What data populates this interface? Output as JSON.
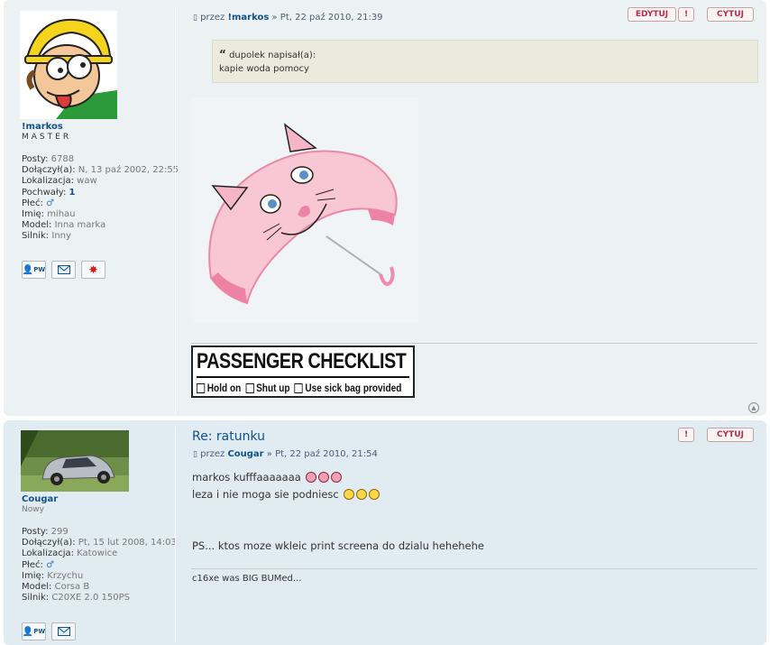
{
  "post1": {
    "author_name": "!markos",
    "rank": "MASTER",
    "fields": [
      {
        "label": "Posty:",
        "value": "6788"
      },
      {
        "label": "Dołączył(a):",
        "value": "N, 13 paź 2002, 22:55"
      },
      {
        "label": "Lokalizacja:",
        "value": "waw"
      },
      {
        "label": "Pochwały:",
        "value": "1"
      },
      {
        "label": "Płeć:",
        "value": "♂"
      },
      {
        "label": "Imię:",
        "value": "mihau"
      },
      {
        "label": "Model:",
        "value": "Inna marka"
      },
      {
        "label": "Silnik:",
        "value": "Inny"
      }
    ],
    "byline_prefix": "przez",
    "byline_author": "!markos",
    "byline_date": "» Pt, 22 paź 2010, 21:39",
    "buttons": {
      "edit": "EDYTUJ",
      "report": "!",
      "quote": "CYTUJ"
    },
    "quote": {
      "cite": "dupolek napisał(a):",
      "text": "kapie woda pomocy"
    },
    "checklist": {
      "title": "PASSENGER CHECKLIST",
      "items": [
        "Hold on",
        "Shut up",
        "Use sick bag provided"
      ]
    },
    "contact_icons": [
      "pm-icon",
      "email-icon",
      "www-icon"
    ]
  },
  "post2": {
    "author_name": "Cougar",
    "rank": "Nowy",
    "fields": [
      {
        "label": "Posty:",
        "value": "299"
      },
      {
        "label": "Dołączył(a):",
        "value": "Pt, 15 lut 2008, 14:03"
      },
      {
        "label": "Lokalizacja:",
        "value": "Katowice"
      },
      {
        "label": "Płeć:",
        "value": "♂"
      },
      {
        "label": "Imię:",
        "value": "Krzychu"
      },
      {
        "label": "Model:",
        "value": "Corsa B"
      },
      {
        "label": "Silnik:",
        "value": "C20XE 2.0 150PS"
      }
    ],
    "title": "Re: ratunku",
    "byline_prefix": "przez",
    "byline_author": "Cougar",
    "byline_date": "» Pt, 22 paź 2010, 21:54",
    "buttons": {
      "report": "!",
      "quote": "CYTUJ"
    },
    "line1": "markos kufffaaaaaaa",
    "line2": "leza i nie moga sie podniesc",
    "line3": "PS... ktos moze wkleic print screena do dzialu hehehehe",
    "signature": "c16xe was BIG BUMed...",
    "contact_icons": [
      "pm-icon",
      "email-icon"
    ]
  },
  "pm_label": "PW",
  "colors": {
    "link": "#105289",
    "post1_bg": "#ecf1f3",
    "post2_bg": "#e1ebf2",
    "button_red": "#bc2a4d"
  }
}
